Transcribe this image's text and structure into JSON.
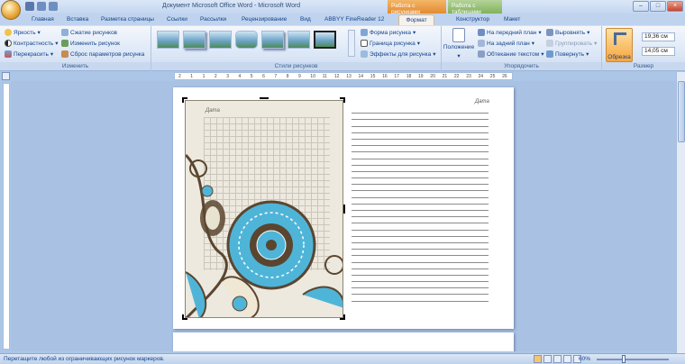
{
  "window": {
    "title": "Документ Microsoft Office Word - Microsoft Word",
    "minimize": "–",
    "maximize": "□",
    "close": "×"
  },
  "context_tabs": {
    "picture_tools": "Работа с рисунками",
    "table_tools": "Работа с таблицами"
  },
  "tabs": [
    "Главная",
    "Вставка",
    "Разметка страницы",
    "Ссылки",
    "Рассылки",
    "Рецензирование",
    "Вид",
    "ABBYY FineReader 12",
    "Формат",
    "Конструктор",
    "Макет"
  ],
  "ribbon": {
    "adjust": {
      "label": "Изменить",
      "brightness": "Яркость",
      "contrast": "Контрастность",
      "recolor": "Перекрасить",
      "compress": "Сжатие рисунков",
      "change": "Изменить рисунок",
      "reset": "Сброс параметров рисунка"
    },
    "styles": {
      "label": "Стили рисунков",
      "shape": "Форма рисунка",
      "border": "Граница рисунка",
      "effects": "Эффекты для рисунка"
    },
    "arrange": {
      "label": "Упорядочить",
      "position": "Положение",
      "front": "На передний план",
      "back": "На задний план",
      "wrap": "Обтекание текстом",
      "align": "Выровнять",
      "group": "Группировать",
      "rotate": "Повернуть"
    },
    "size": {
      "label": "Размер",
      "crop": "Обрезка",
      "height": "19,36 см",
      "width": "14,05 см"
    }
  },
  "ruler": {
    "marks": [
      "2",
      "1",
      "1",
      "2",
      "3",
      "4",
      "5",
      "6",
      "7",
      "8",
      "9",
      "10",
      "11",
      "12",
      "13",
      "14",
      "15",
      "16",
      "17",
      "18",
      "19",
      "20",
      "21",
      "22",
      "23",
      "24",
      "25",
      "26"
    ]
  },
  "document": {
    "date_left": "Дата",
    "date_right": "Дата"
  },
  "status": {
    "text": "Перетащите любой из ограничивающих рисунок маркеров.",
    "zoom": "60%"
  },
  "colors": {
    "accent": "#15428b",
    "flower_blue": "#4fb5d8",
    "brown": "#5a4630"
  }
}
